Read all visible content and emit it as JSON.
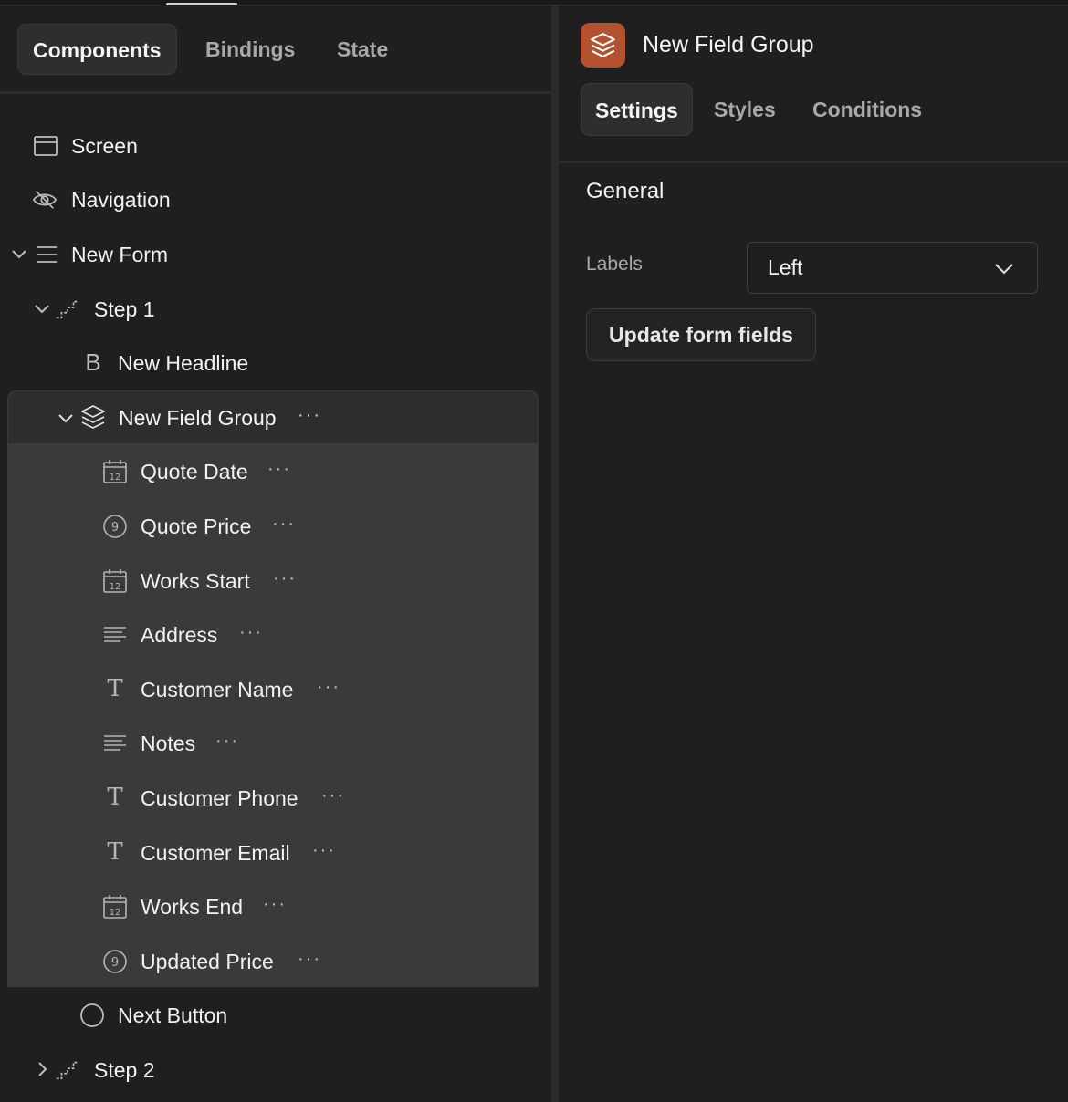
{
  "left_tabs": {
    "components": "Components",
    "bindings": "Bindings",
    "state": "State"
  },
  "tree": {
    "screen": "Screen",
    "navigation": "Navigation",
    "new_form": "New Form",
    "step1": "Step 1",
    "new_headline": "New Headline",
    "new_field_group": "New Field Group",
    "fields": [
      {
        "label": "Quote Date",
        "icon": "calendar-icon"
      },
      {
        "label": "Quote Price",
        "icon": "number-icon"
      },
      {
        "label": "Works Start",
        "icon": "calendar-icon"
      },
      {
        "label": "Address",
        "icon": "paragraph-icon"
      },
      {
        "label": "Customer Name",
        "icon": "text-icon"
      },
      {
        "label": "Notes",
        "icon": "paragraph-icon"
      },
      {
        "label": "Customer Phone",
        "icon": "text-icon"
      },
      {
        "label": "Customer Email",
        "icon": "text-icon"
      },
      {
        "label": "Works End",
        "icon": "calendar-icon"
      },
      {
        "label": "Updated Price",
        "icon": "number-icon"
      }
    ],
    "next_button": "Next Button",
    "step2": "Step 2",
    "more": "···"
  },
  "inspector": {
    "title": "New Field Group",
    "tabs": {
      "settings": "Settings",
      "styles": "Styles",
      "conditions": "Conditions"
    },
    "section": "General",
    "labels_label": "Labels",
    "labels_value": "Left",
    "update_button": "Update form fields",
    "accent_color": "#b4512f"
  },
  "icon_glyphs": {
    "number": "9",
    "calendar": "12",
    "text": "T",
    "bold": "B"
  }
}
